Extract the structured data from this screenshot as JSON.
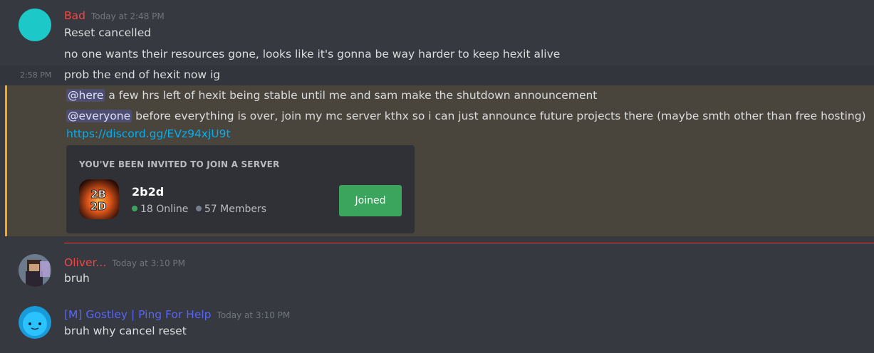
{
  "messages": {
    "bad": {
      "author": "Bad",
      "author_color": "#f04747",
      "timestamp": "Today at 2:48 PM",
      "lines": [
        "Reset cancelled",
        "no one wants their resources gone, looks like it's gonna be way harder to keep hexit alive"
      ],
      "followup": {
        "timestamp": "2:58 PM",
        "text": "prob the end of hexit now ig"
      },
      "here_mention": "@here",
      "here_text": "a few hrs left of hexit being stable until me and sam make the shutdown announcement",
      "everyone_mention": "@everyone",
      "everyone_text": "before everything is over, join my mc server kthx so i can just announce future projects there (maybe smth other than free hosting)",
      "invite_link": "https://discord.gg/EVz94xjU9t",
      "invite": {
        "header": "YOU'VE BEEN INVITED TO JOIN A SERVER",
        "server_name": "2b2d",
        "online": "18 Online",
        "members": "57 Members",
        "button_label": "Joined",
        "icon_text_top": "2B",
        "icon_text_bottom": "2D"
      }
    },
    "oliver": {
      "author": "Oliver...",
      "author_color": "#f04747",
      "timestamp": "Today at 3:10 PM",
      "text": "bruh"
    },
    "gostley": {
      "author": "[M] Gostley | Ping For Help",
      "author_color": "#5865f2",
      "timestamp": "Today at 3:10 PM",
      "text": "bruh why cancel reset"
    }
  }
}
